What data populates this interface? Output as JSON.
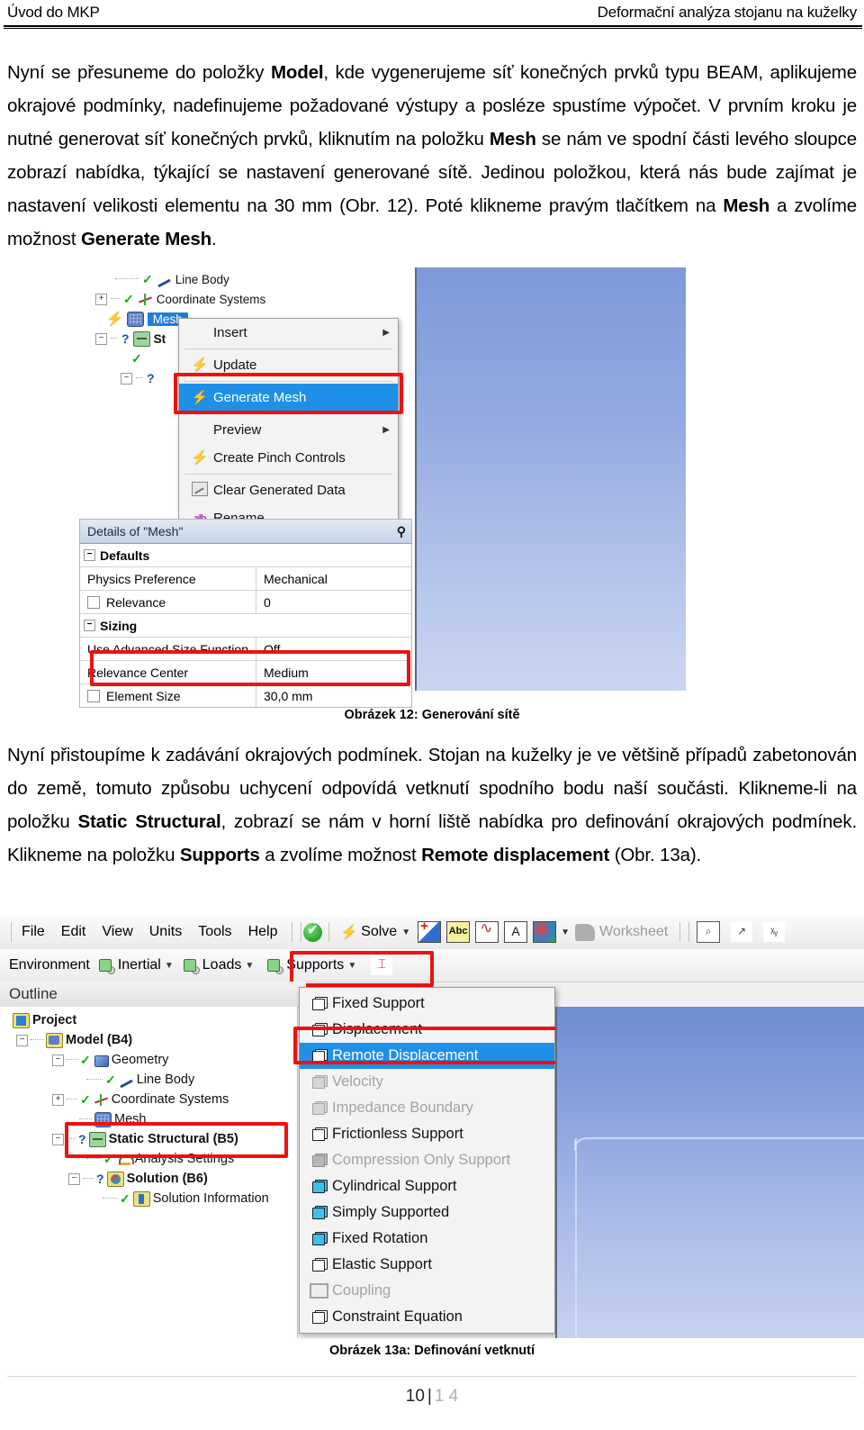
{
  "header": {
    "left": "Úvod do MKP",
    "right": "Deformační analýza stojanu na kuželky"
  },
  "paragraph1": {
    "seg1": "Nyní se přesuneme do položky ",
    "b1": "Model",
    "seg2": ", kde vygenerujeme síť konečných prvků typu BEAM, aplikujeme okrajové podmínky, nadefinujeme požadované výstupy a posléze spustíme výpočet. V prvním kroku je nutné generovat síť konečných prvků, kliknutím na položku ",
    "b2": "Mesh",
    "seg3": " se nám ve spodní části levého sloupce zobrazí nabídka, týkající se nastavení generované sítě. Jedinou položkou, která nás bude zajímat je nastavení velikosti elementu na 30 mm (Obr. 12). Poté klikneme pravým tlačítkem na ",
    "b3": "Mesh",
    "seg4": " a zvolíme možnost ",
    "b4": "Generate Mesh",
    "seg5": "."
  },
  "caption1": "Obrázek 12: Generování sítě",
  "paragraph2": {
    "seg1": "Nyní přistoupíme k zadávání okrajových podmínek. Stojan na kuželky je ve většině případů zabetonován do země, tomuto způsobu uchycení odpovídá vetknutí spodního bodu naší součásti. Klikneme-li na položku ",
    "b1": "Static Structural",
    "seg2": ", zobrazí se nám v horní liště nabídka pro definování okrajových podmínek. Klikneme na položku ",
    "b2": "Supports",
    "seg3": " a zvolíme možnost ",
    "b3": "Remote displacement",
    "seg4": " (Obr. 13a)."
  },
  "caption2": "Obrázek 13a: Definování vetknutí",
  "footer": {
    "page": "10",
    "separator": "|",
    "total": "1 4"
  },
  "figure1": {
    "tree": [
      {
        "label": "Line Body"
      },
      {
        "label": "Coordinate Systems"
      },
      {
        "label": "Mesh"
      },
      {
        "label": "St"
      }
    ],
    "context_menu": [
      {
        "label": "Insert",
        "submenu": "▶",
        "highlight": false
      },
      {
        "label": "Update",
        "submenu": "",
        "highlight": false
      },
      {
        "label": "Generate Mesh",
        "submenu": "",
        "highlight": true
      },
      {
        "label": "Preview",
        "submenu": "▶",
        "highlight": false
      },
      {
        "label": "Create Pinch Controls",
        "submenu": "",
        "highlight": false
      },
      {
        "label": "Clear Generated Data",
        "submenu": "",
        "highlight": false
      },
      {
        "label": "Rename",
        "submenu": "",
        "highlight": false
      }
    ],
    "details": {
      "title": "Details of \"Mesh\"",
      "rows": [
        {
          "kind": "group",
          "key": "Defaults",
          "value": ""
        },
        {
          "kind": "row",
          "key": "Physics Preference",
          "value": "Mechanical"
        },
        {
          "kind": "check",
          "key": "Relevance",
          "value": "0"
        },
        {
          "kind": "group",
          "key": "Sizing",
          "value": ""
        },
        {
          "kind": "row",
          "key": "Use Advanced Size Function",
          "value": "Off"
        },
        {
          "kind": "row",
          "key": "Relevance Center",
          "value": "Medium"
        },
        {
          "kind": "check",
          "key": "Element Size",
          "value": "30,0 mm"
        }
      ]
    }
  },
  "figure2": {
    "menubar": [
      "File",
      "Edit",
      "View",
      "Units",
      "Tools",
      "Help"
    ],
    "toolbar": {
      "solve_label": "Solve",
      "worksheet_label": "Worksheet",
      "abc_label": "Abc",
      "a_label": "A"
    },
    "toolbar2": {
      "environment": "Environment",
      "inertial": "Inertial",
      "loads": "Loads",
      "supports": "Supports"
    },
    "outline_title": "Outline",
    "tree": [
      {
        "label": "Project"
      },
      {
        "label": "Model (B4)"
      },
      {
        "label": "Geometry"
      },
      {
        "label": "Line Body"
      },
      {
        "label": "Coordinate Systems"
      },
      {
        "label": "Mesh"
      },
      {
        "label": "Static Structural (B5)"
      },
      {
        "label": "Analysis Settings"
      },
      {
        "label": "Solution (B6)"
      },
      {
        "label": "Solution Information"
      }
    ],
    "supports_menu": [
      {
        "label": "Fixed Support",
        "state": "enabled",
        "icon": "cube-white"
      },
      {
        "label": "Displacement",
        "state": "enabled",
        "icon": "cube-white"
      },
      {
        "label": "Remote Displacement",
        "state": "selected",
        "icon": "cube-white"
      },
      {
        "label": "Velocity",
        "state": "disabled",
        "icon": "cube-gray"
      },
      {
        "label": "Impedance Boundary",
        "state": "disabled",
        "icon": "cube-gray"
      },
      {
        "label": "Frictionless Support",
        "state": "enabled",
        "icon": "cube-white"
      },
      {
        "label": "Compression Only Support",
        "state": "disabled",
        "icon": "cube-solid"
      },
      {
        "label": "Cylindrical Support",
        "state": "enabled",
        "icon": "cube-blue"
      },
      {
        "label": "Simply Supported",
        "state": "enabled",
        "icon": "cube-blue"
      },
      {
        "label": "Fixed Rotation",
        "state": "enabled",
        "icon": "cube-blue"
      },
      {
        "label": "Elastic Support",
        "state": "enabled",
        "icon": "cube-white"
      },
      {
        "label": "Coupling",
        "state": "disabled",
        "icon": "coupling"
      },
      {
        "label": "Constraint Equation",
        "state": "enabled",
        "icon": "cube-white"
      }
    ]
  },
  "colors": {
    "highlight_red": "#ee1111",
    "selection_blue": "#1e90e8",
    "viewport_top": "#6f8dd2",
    "viewport_bottom": "#c6d2f0"
  }
}
